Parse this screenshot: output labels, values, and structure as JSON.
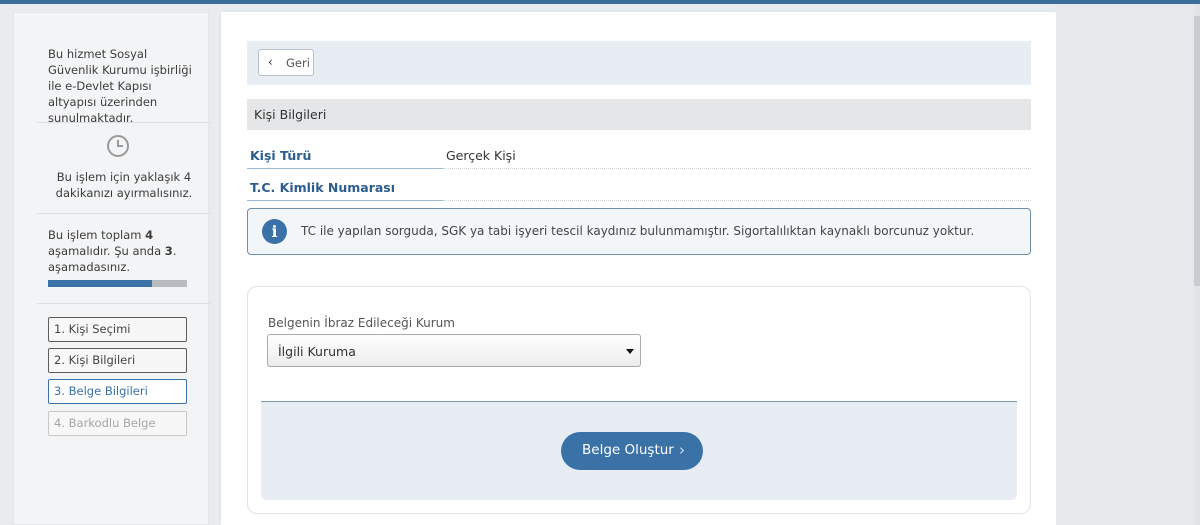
{
  "sidebar": {
    "intro": "Bu hizmet Sosyal Güvenlik Kurumu işbirliği ile e-Devlet Kapısı altyapısı üzerinden sunulmaktadır.",
    "time_note": "Bu işlem için yaklaşık 4 dakikanızı ayırmalısınız.",
    "steps_note": {
      "p1": "Bu işlem toplam ",
      "total": "4",
      "p2": " aşamalıdır. Şu anda ",
      "current": "3",
      "p3": ". aşamadasınız."
    },
    "progress_fraction": 0.75,
    "steps": [
      {
        "label": "1. Kişi Seçimi",
        "state": "done"
      },
      {
        "label": "2. Kişi Bilgileri",
        "state": "done"
      },
      {
        "label": "3. Belge Bilgileri",
        "state": "active"
      },
      {
        "label": "4. Barkodlu Belge",
        "state": "disabled"
      }
    ]
  },
  "main": {
    "back_label": "Geri",
    "section_title": "Kişi Bilgileri",
    "fields": [
      {
        "label": "Kişi Türü",
        "value": "Gerçek Kişi"
      },
      {
        "label": "T.C. Kimlik Numarası",
        "value": ""
      }
    ],
    "info_message": "TC ile yapılan sorguda, SGK ya tabi işyeri tescil kaydınız bulunmamıştır. Sigortalılıktan kaynaklı borcunuz yoktur.",
    "form": {
      "institution_label": "Belgenin İbraz Edileceği Kurum",
      "institution_value": "İlgili Kuruma",
      "submit_label": "Belge Oluştur"
    }
  },
  "colors": {
    "accent": "#3a72a8",
    "top_bar": "#3a6d9c",
    "label_blue": "#2c5d8f"
  },
  "icons": [
    "clock-icon",
    "chevron-left-icon",
    "info-icon",
    "caret-down-icon",
    "chevron-right-icon"
  ]
}
